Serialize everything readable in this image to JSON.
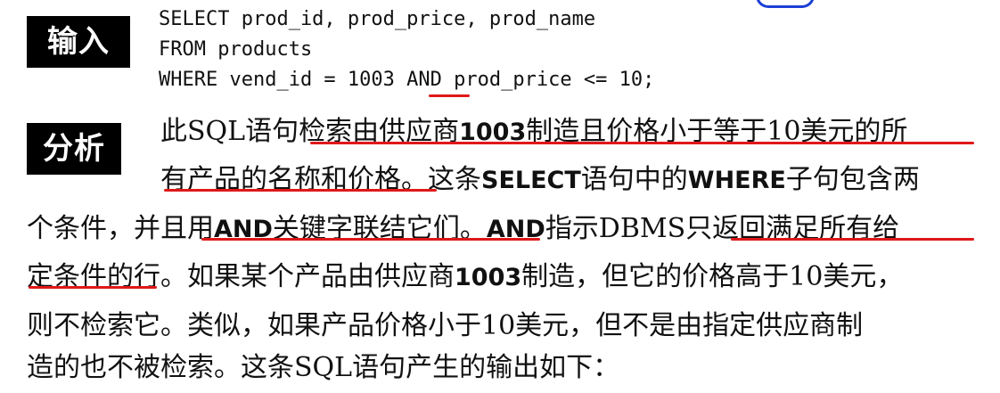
{
  "tags": {
    "input": "输入",
    "analysis": "分析"
  },
  "code": {
    "line1": "SELECT prod_id, prod_price, prod_name",
    "line2": "FROM products",
    "line3_a": "WHERE vend_id = 1003 ",
    "line3_and": "AND",
    "line3_b": " prod_price <= 10;"
  },
  "paragraph": {
    "l1_a": "此SQL语句",
    "l1_b": "检索由供应商",
    "l1_c": "1003",
    "l1_d": "制造且价格小于等于10美元的所",
    "l2_a": "有产品的名称和价格",
    "l2_b": "。这条",
    "l2_c": "SELECT",
    "l2_d": "语句中的",
    "l2_e": "WHERE",
    "l2_f": "子句包含两",
    "l3_a": "个条件，",
    "l3_b": "并且用",
    "l3_c": "AND",
    "l3_d": "关键字联结它们。",
    "l3_e": "AND",
    "l3_f": "指示DBMS",
    "l3_g": "只返回满足所有给",
    "l4_a": "定条件的行",
    "l4_b": "。如果某个产品由供应商",
    "l4_c": "1003",
    "l4_d": "制造，但它的价格高于10美元，",
    "l5": "则不检索它。类似，如果产品价格小于10美元，但不是由指定供应商制",
    "l6": "造的也不被检索。这条SQL语句产生的输出如下："
  }
}
